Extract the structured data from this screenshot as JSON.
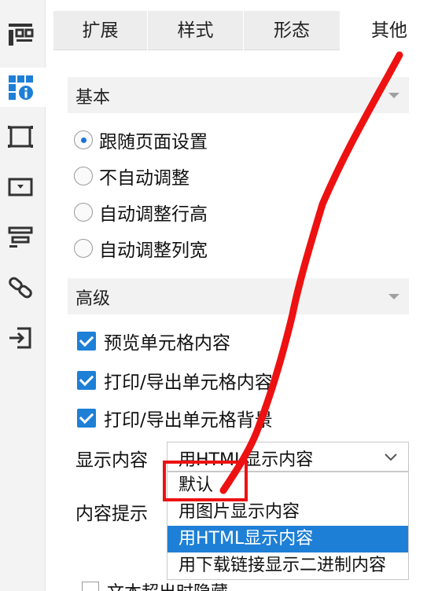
{
  "tabs": [
    {
      "label": "扩展"
    },
    {
      "label": "样式"
    },
    {
      "label": "形态"
    },
    {
      "label": "其他"
    }
  ],
  "sections": {
    "basic": {
      "title": "基本"
    },
    "advanced": {
      "title": "高级"
    }
  },
  "auto_adjust": {
    "options": [
      {
        "label": "跟随页面设置",
        "selected": true
      },
      {
        "label": "不自动调整",
        "selected": false
      },
      {
        "label": "自动调整行高",
        "selected": false
      },
      {
        "label": "自动调整列宽",
        "selected": false
      }
    ]
  },
  "advanced_checks": [
    {
      "label": "预览单元格内容",
      "checked": true
    },
    {
      "label": "打印/导出单元格内容",
      "checked": true
    },
    {
      "label": "打印/导出单元格背景",
      "checked": true
    }
  ],
  "display_content": {
    "label": "显示内容",
    "value": "用HTML显示内容",
    "options": [
      {
        "label": "默认"
      },
      {
        "label": "用图片显示内容"
      },
      {
        "label": "用HTML显示内容"
      },
      {
        "label": "用下载链接显示二进制内容"
      }
    ]
  },
  "content_tooltip": {
    "label": "内容提示"
  },
  "overflow_hide": {
    "label": "文本超出时隐藏"
  },
  "colors": {
    "accent": "#1e7fd6",
    "annotation": "#ee1111"
  }
}
